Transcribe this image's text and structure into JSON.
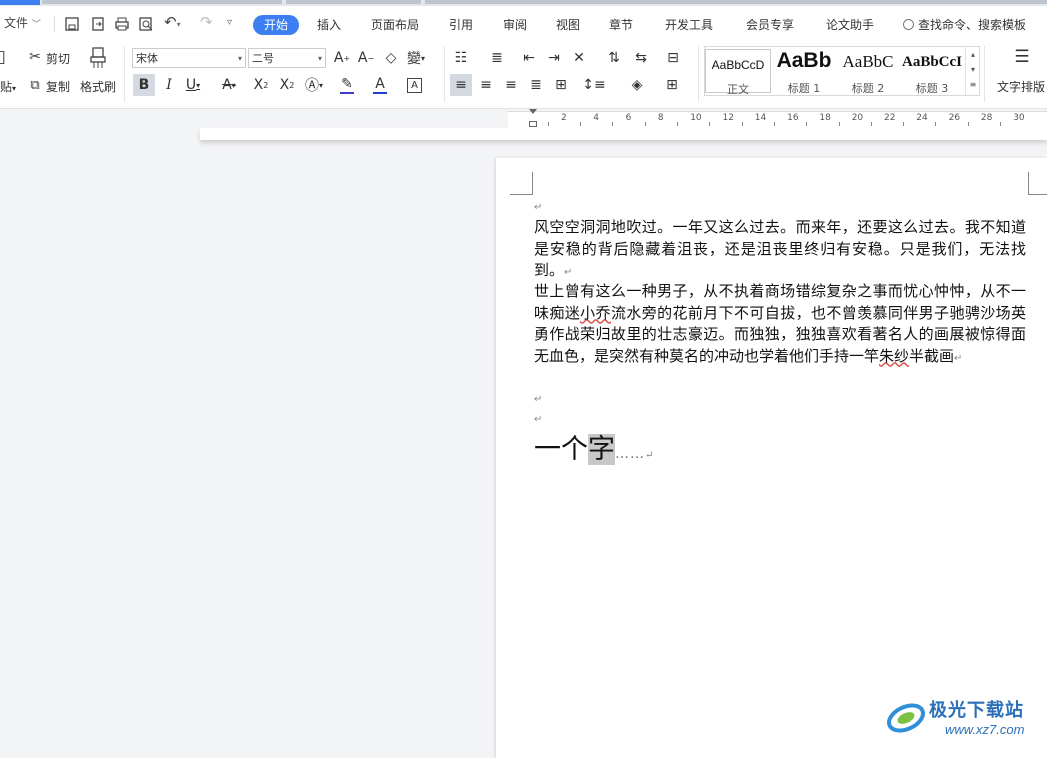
{
  "qat": {
    "file_label": "文件"
  },
  "tabs": [
    "开始",
    "插入",
    "页面布局",
    "引用",
    "审阅",
    "视图",
    "章节",
    "开发工具",
    "会员专享",
    "论文助手"
  ],
  "active_tab": "开始",
  "search": {
    "label": "查找命令、搜索模板"
  },
  "clipboard": {
    "cut": "剪切",
    "copy": "复制",
    "paste_partial": "贴",
    "format_painter": "格式刷"
  },
  "font": {
    "family": "宋体",
    "size": "二号"
  },
  "styles": [
    {
      "preview": "AaBbCcD",
      "name": "正文"
    },
    {
      "preview": "AaBb",
      "name": "标题 1"
    },
    {
      "preview": "AaBbC",
      "name": "标题 2"
    },
    {
      "preview": "AaBbCcI",
      "name": "标题 3"
    }
  ],
  "text_layout_label": "文字排版",
  "ruler_numbers": [
    "2",
    "4",
    "6",
    "8",
    "10",
    "12",
    "14",
    "16",
    "18",
    "20",
    "22",
    "24",
    "26",
    "28",
    "30"
  ],
  "doc": {
    "para1": "风空空洞洞地吹过。一年又这么过去。而来年，还要这么过去。我不知道是安稳的背后隐藏着沮丧，还是沮丧里终归有安稳。只是我们，无法找到。",
    "para2_a": "世上曾有这么一种男子，从不执着商场错综复杂之事而忧心忡忡，从不一味痴迷",
    "para2_wavy1": "小乔",
    "para2_b": "流水旁的花前月下不可自拔，也不曾羡慕同伴男子驰骋沙场英勇作战荣归故里的壮志豪迈。而独独，独独喜欢看著名人的画展被惊得面无血色，是突然有种莫名的冲动也学着他们手持一竿",
    "para2_wavy2": "朱纱",
    "para2_c": "半截画",
    "big_prefix": "一个",
    "big_selected": "字",
    "big_dots": "……",
    "para_mark": "↵"
  },
  "watermark": {
    "brand": "极光下载站",
    "url": "www.xz7.com"
  },
  "colors": {
    "accent": "#3d7ff1",
    "highlight": "#c8c8c8",
    "font_color_bar": "#1f3fcf",
    "highlight_bar": "#3d3dc9"
  }
}
